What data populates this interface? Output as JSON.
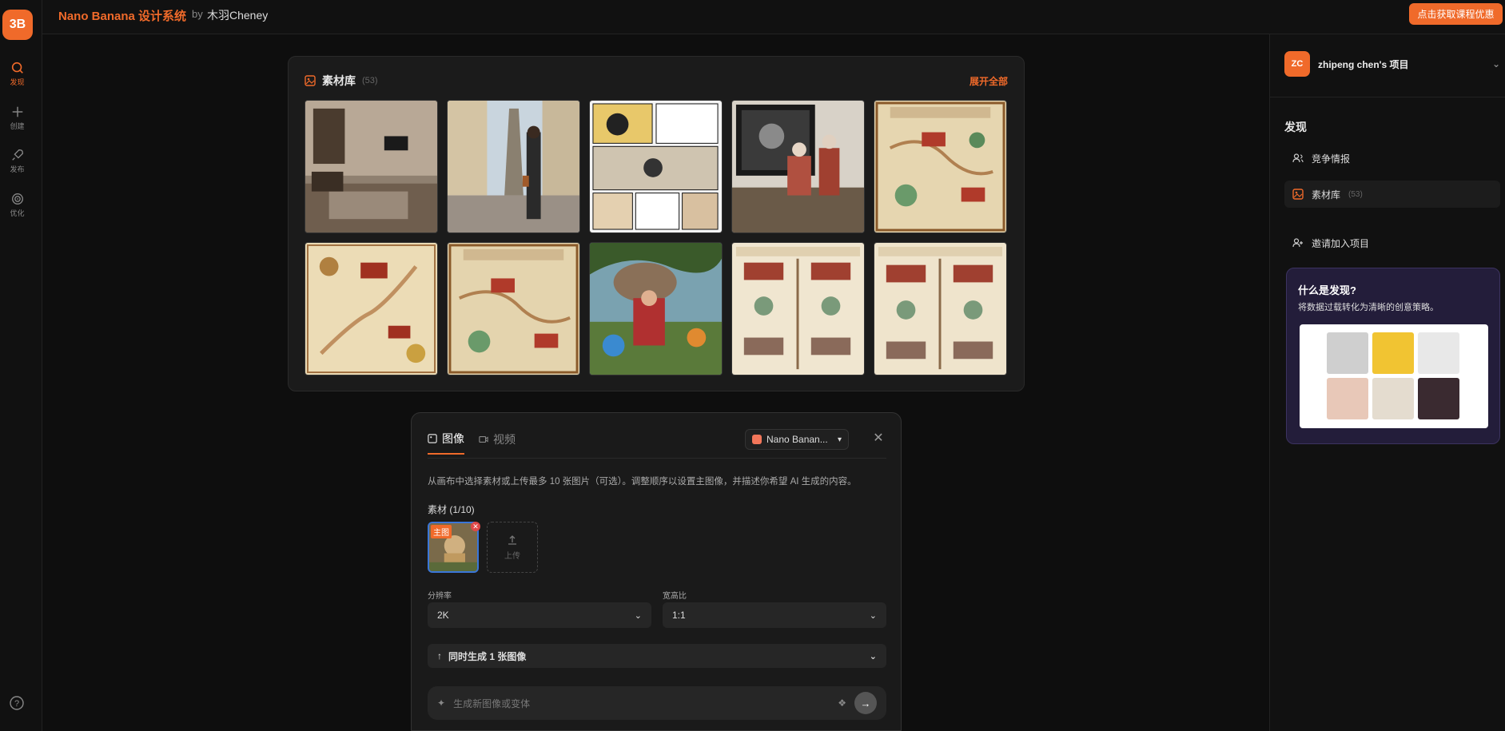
{
  "app": {
    "logo_text": "3B",
    "brand_title": "Nano Banana 设计系统",
    "by": "by",
    "author": "木羽Cheney",
    "promo_button": "点击获取课程优惠",
    "accent_color": "#f06a2a"
  },
  "rail": {
    "items": [
      {
        "label": "发现",
        "icon": "search-icon"
      },
      {
        "label": "创建",
        "icon": "plus-icon"
      },
      {
        "label": "发布",
        "icon": "rocket-icon"
      },
      {
        "label": "优化",
        "icon": "target-icon"
      }
    ],
    "help_icon": "help-icon"
  },
  "library": {
    "title": "素材库",
    "count": "(53)",
    "expand_label": "展开全部",
    "thumbnails": [
      "interior-living-room",
      "eiffel-tower-street",
      "manga-page",
      "figurine-on-desk",
      "beijing-travel-map",
      "beijing-ornate-map",
      "beijing-travel-map-2",
      "cartoon-characters-boulder",
      "two-day-travel-map",
      "two-day-travel-map-2"
    ]
  },
  "composer": {
    "tab_image": "图像",
    "tab_video": "视频",
    "model_name": "Nano Banan...",
    "hint": "从画布中选择素材或上传最多 10 张图片（可选）。调整顺序以设置主图像，并描述你希望 AI 生成的内容。",
    "materials_label": "素材 (1/10)",
    "main_badge": "主图",
    "upload_label": "上传",
    "resolution_label": "分辨率",
    "resolution_value": "2K",
    "aspect_label": "宽高比",
    "aspect_value": "1:1",
    "batch_label": "同时生成 1 张图像",
    "prompt_placeholder": "生成新图像或变体"
  },
  "sidebar": {
    "avatar": "ZC",
    "project": "zhipeng chen's 项目",
    "section_title": "发现",
    "items": [
      {
        "label": "竞争情报",
        "icon": "users-icon"
      },
      {
        "label": "素材库",
        "count": "(53)",
        "icon": "image-icon"
      },
      {
        "label": "邀请加入项目",
        "icon": "user-plus-icon"
      }
    ],
    "card_title": "什么是发现?",
    "card_sub": "将数据过载转化为清晰的创意策略。"
  }
}
